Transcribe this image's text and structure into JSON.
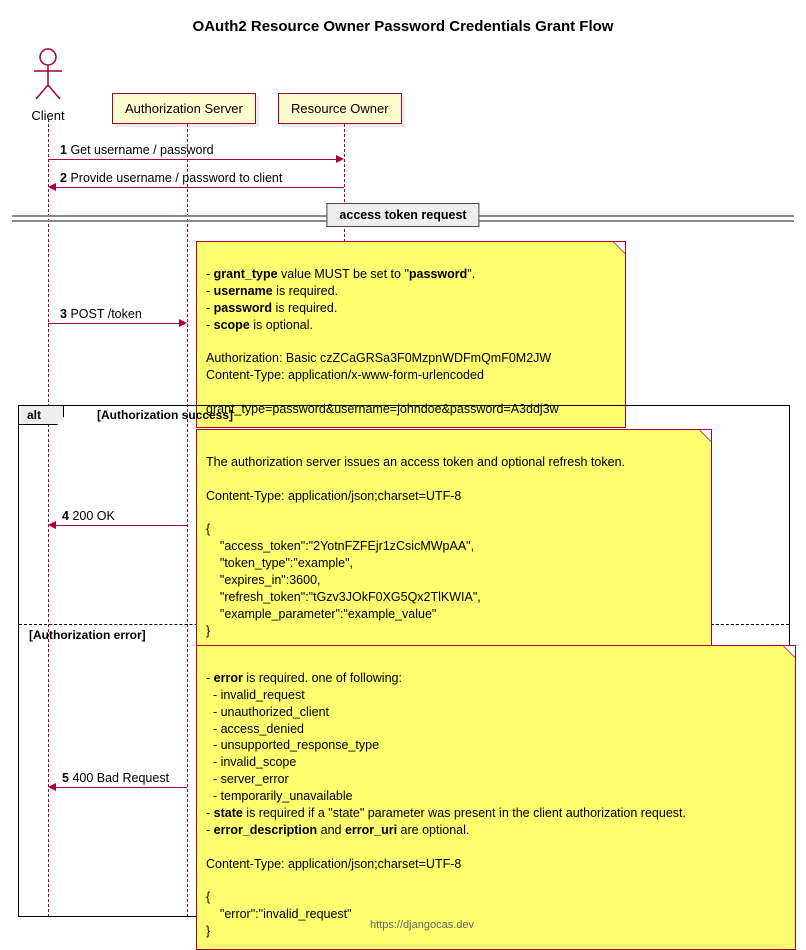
{
  "title": "OAuth2 Resource Owner Password Credentials Grant Flow",
  "actors": {
    "client": "Client",
    "authz_server": "Authorization Server",
    "resource_owner": "Resource Owner"
  },
  "divider": "access token request",
  "messages": {
    "m1": {
      "num": "1",
      "text": "Get username / password"
    },
    "m2": {
      "num": "2",
      "text": "Provide username / password to client"
    },
    "m3": {
      "num": "3",
      "text": "POST /token"
    },
    "m4": {
      "num": "4",
      "text": "200 OK"
    },
    "m5": {
      "num": "5",
      "text": "400 Bad Request"
    }
  },
  "alt": {
    "label": "alt",
    "cond_success": "[Authorization success]",
    "cond_error": "[Authorization error]"
  },
  "notes": {
    "post_token": {
      "l1a": "- ",
      "l1b": "grant_type",
      "l1c": " value MUST be set to \"",
      "l1d": "password",
      "l1e": "\".",
      "l2a": "- ",
      "l2b": "username",
      "l2c": " is required.",
      "l3a": "- ",
      "l3b": "password",
      "l3c": " is required.",
      "l4a": "- ",
      "l4b": "scope",
      "l4c": " is optional.",
      "l6": "Authorization: Basic czZCaGRSa3F0MzpnWDFmQmF0M2JW",
      "l7": "Content-Type: application/x-www-form-urlencoded",
      "l9": "grant_type=password&username=johndoe&password=A3ddj3w"
    },
    "ok": {
      "l1": "The authorization server issues an access token and optional refresh token.",
      "l3": "Content-Type: application/json;charset=UTF-8",
      "l5": "{",
      "l6": "    \"access_token\":\"2YotnFZFEjr1zCsicMWpAA\",",
      "l7": "    \"token_type\":\"example\",",
      "l8": "    \"expires_in\":3600,",
      "l9": "    \"refresh_token\":\"tGzv3JOkF0XG5Qx2TlKWIA\",",
      "l10": "    \"example_parameter\":\"example_value\"",
      "l11": "}"
    },
    "err": {
      "l1a": "- ",
      "l1b": "error",
      "l1c": " is required. one of following:",
      "l2": "  - invalid_request",
      "l3": "  - unauthorized_client",
      "l4": "  - access_denied",
      "l5": "  - unsupported_response_type",
      "l6": "  - invalid_scope",
      "l7": "  - server_error",
      "l8": "  - temporarily_unavailable",
      "l9a": "- ",
      "l9b": "state",
      "l9c": " is required if a \"state\" parameter was present in the client authorization request.",
      "l10a": "- ",
      "l10b": "error_description",
      "l10c": " and ",
      "l10d": "error_uri",
      "l10e": " are optional.",
      "l12": "Content-Type: application/json;charset=UTF-8",
      "l14": "{",
      "l15": "    \"error\":\"invalid_request\"",
      "l16": "}"
    }
  },
  "footer": "https://djangocas.dev",
  "chart_data": {
    "type": "sequence-diagram",
    "title": "OAuth2 Resource Owner Password Credentials Grant Flow",
    "participants": [
      {
        "id": "client",
        "name": "Client",
        "kind": "actor"
      },
      {
        "id": "authz",
        "name": "Authorization Server",
        "kind": "participant"
      },
      {
        "id": "owner",
        "name": "Resource Owner",
        "kind": "participant"
      }
    ],
    "messages": [
      {
        "n": 1,
        "from": "client",
        "to": "owner",
        "label": "Get username / password"
      },
      {
        "n": 2,
        "from": "owner",
        "to": "client",
        "label": "Provide username / password to client"
      },
      {
        "divider": "access token request"
      },
      {
        "n": 3,
        "from": "client",
        "to": "authz",
        "label": "POST /token",
        "note_right_of": "authz",
        "note": "grant_type MUST be \"password\"; username required; password required; scope optional. Authorization: Basic czZCaGRSa3F0MzpnWDFmQmF0M2JW; Content-Type: application/x-www-form-urlencoded; body grant_type=password&username=johndoe&password=A3ddj3w"
      },
      {
        "alt": [
          {
            "guard": "Authorization success",
            "messages": [
              {
                "n": 4,
                "from": "authz",
                "to": "client",
                "label": "200 OK",
                "note_right_of": "authz",
                "note": "Server issues access token and optional refresh token. Content-Type: application/json;charset=UTF-8. {\"access_token\":\"2YotnFZFEjr1zCsicMWpAA\",\"token_type\":\"example\",\"expires_in\":3600,\"refresh_token\":\"tGzv3JOkF0XG5Qx2TlKWIA\",\"example_parameter\":\"example_value\"}"
              }
            ]
          },
          {
            "guard": "Authorization error",
            "messages": [
              {
                "n": 5,
                "from": "authz",
                "to": "client",
                "label": "400 Bad Request",
                "note_right_of": "authz",
                "note": "error required (invalid_request | unauthorized_client | access_denied | unsupported_response_type | invalid_scope | server_error | temporarily_unavailable); state required if present in original request; error_description and error_uri optional. Content-Type: application/json;charset=UTF-8. {\"error\":\"invalid_request\"}"
              }
            ]
          }
        ]
      }
    ]
  }
}
